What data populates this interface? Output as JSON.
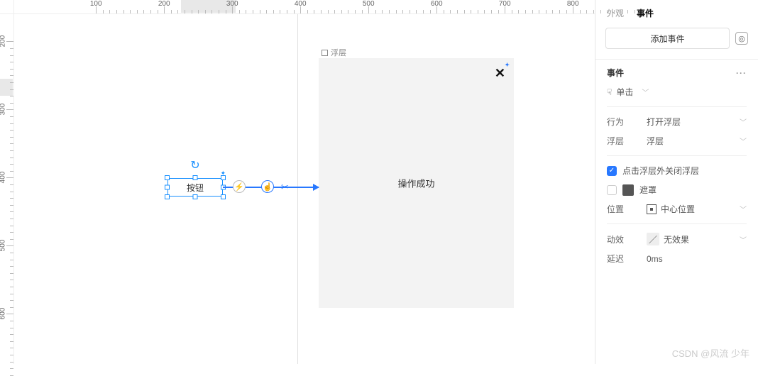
{
  "ruler": {
    "h_ticks": [
      100,
      200,
      300,
      400,
      500,
      600,
      700,
      800
    ],
    "h_hilite": {
      "from": 225,
      "to": 305
    },
    "v_ticks": [
      200,
      300,
      400,
      500,
      600
    ],
    "v_hilite": {
      "from": 255,
      "to": 280
    }
  },
  "canvas": {
    "button_label": "按钮",
    "popup_name": "浮层",
    "popup_message": "操作成功"
  },
  "side": {
    "tabs": {
      "appearance": "外观",
      "events": "事件",
      "active": "events"
    },
    "add_event": "添加事件",
    "events_header": "事件",
    "trigger": "单击",
    "rows": {
      "action_label": "行为",
      "action_value": "打开浮层",
      "layer_label": "浮层",
      "layer_value": "浮层",
      "close_outside": "点击浮层外关闭浮层",
      "mask": "遮罩",
      "pos_label": "位置",
      "pos_value": "中心位置",
      "effect_label": "动效",
      "effect_value": "无效果",
      "delay_label": "延迟",
      "delay_value": "0ms"
    }
  },
  "watermark": "CSDN @风流 少年"
}
